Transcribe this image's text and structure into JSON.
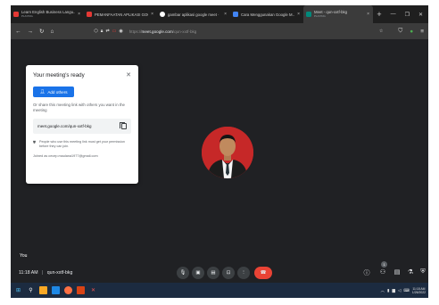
{
  "browser": {
    "tabs": [
      {
        "title": "Learn English Business Langu...",
        "subtitle": "PLAYING",
        "favicon_color": "#e53935"
      },
      {
        "title": "PEMANFAATAN APLIKASI GOO",
        "subtitle": "",
        "favicon_color": "#e53935"
      },
      {
        "title": "gambar aplikasi google meet ·",
        "subtitle": "",
        "favicon_color": "#ffffff"
      },
      {
        "title": "Cara Menggunakan Google M...",
        "subtitle": "",
        "favicon_color": "#4285f4"
      },
      {
        "title": "Meet - qun-xxtf-bkg",
        "subtitle": "PLAYING",
        "favicon_color": "#00897b"
      }
    ],
    "new_tab": "+",
    "url_prefix": "https://",
    "url_domain": "meet.google.com",
    "url_path": "/qun-xxtf-bkg"
  },
  "dialog": {
    "title": "Your meeting's ready",
    "add_others_label": "Add others",
    "share_text": "Or share this meeting link with others you want in the meeting",
    "meeting_link": "meet.google.com/qun-xxtf-bkg",
    "warning_text": "People who use this meeting link must get your permission before they can join.",
    "joined_as": "Joined as cecep.maulana1977@gmail.com"
  },
  "participant": {
    "you_label": "You"
  },
  "controls": {
    "time": "11:18 AM",
    "separator": "|",
    "meeting_code": "qun-xxtf-bkg",
    "people_count": "1"
  },
  "taskbar": {
    "time": "11:18 AM",
    "date": "1/26/2022"
  },
  "colors": {
    "accent": "#1a73e8",
    "end_call": "#ea4335",
    "meet_background": "#202124"
  }
}
